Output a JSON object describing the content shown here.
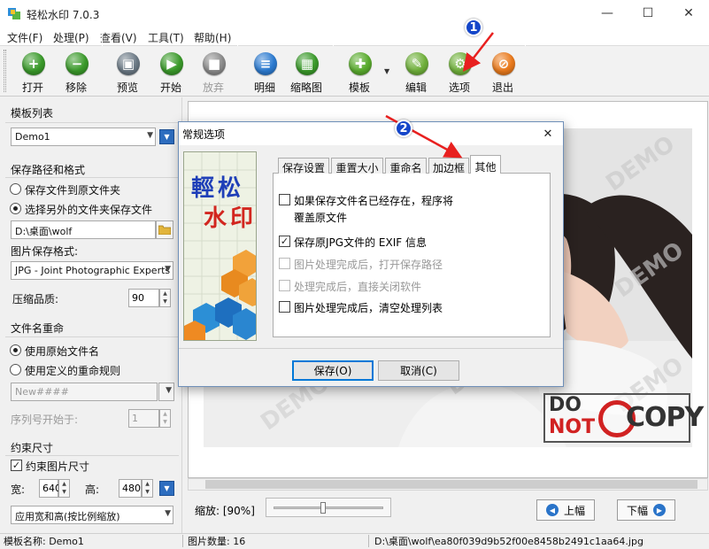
{
  "window": {
    "title": "轻松水印 7.0.3",
    "minimize_glyph": "—",
    "maximize_glyph": "☐",
    "close_glyph": "✕"
  },
  "menu": {
    "items": [
      "文件(F)",
      "处理(P)",
      "查看(V)",
      "工具(T)",
      "帮助(H)"
    ]
  },
  "toolbar": {
    "buttons": [
      {
        "label": "打开",
        "icon": "plus-icon",
        "glyph": "+",
        "color": "#3a9a2a",
        "enabled": true
      },
      {
        "label": "移除",
        "icon": "minus-icon",
        "glyph": "−",
        "color": "#3a9a2a",
        "enabled": true
      },
      {
        "label": "预览",
        "icon": "monitor-icon",
        "glyph": "▣",
        "color": "#6c7a86",
        "enabled": true
      },
      {
        "label": "开始",
        "icon": "play-icon",
        "glyph": "▶",
        "color": "#3a9a2a",
        "enabled": true
      },
      {
        "label": "放弃",
        "icon": "stop-icon",
        "glyph": "■",
        "color": "#8c8c8c",
        "enabled": false
      },
      {
        "label": "明细",
        "icon": "document-icon",
        "glyph": "≡",
        "color": "#2c7bd1",
        "enabled": true
      },
      {
        "label": "缩略图",
        "icon": "grid-icon",
        "glyph": "▦",
        "color": "#3a9a2a",
        "enabled": true
      },
      {
        "label": "模板",
        "icon": "puzzle-icon",
        "glyph": "✚",
        "color": "#5aac2e",
        "enabled": true
      },
      {
        "label": "编辑",
        "icon": "pencil-icon",
        "glyph": "✎",
        "color": "#6fb03a",
        "enabled": true
      },
      {
        "label": "选项",
        "icon": "wrench-icon",
        "glyph": "⚙",
        "color": "#6fb03a",
        "enabled": true
      },
      {
        "label": "退出",
        "icon": "power-icon",
        "glyph": "⊘",
        "color": "#ea7a1c",
        "enabled": true
      }
    ],
    "dropdown_glyph": "▼"
  },
  "left_panel": {
    "template_list_title": "模板列表",
    "template_selected": "Demo1",
    "save_section_title": "保存路径和格式",
    "save_to_original": "保存文件到原文件夹",
    "save_to_other": "选择另外的文件夹保存文件",
    "save_path": "D:\\桌面\\wolf",
    "format_label": "图片保存格式:",
    "format_value": "JPG - Joint Photographic Experts G",
    "quality_label": "压缩品质:",
    "quality_value": "90",
    "rename_section_title": "文件名重命",
    "use_original_name": "使用原始文件名",
    "use_custom_rule": "使用定义的重命规则",
    "rename_pattern": "New####",
    "seq_start_label": "序列号开始于:",
    "seq_start_value": "1",
    "constraint_section_title": "约束尺寸",
    "constrain_check_label": "约束图片尺寸",
    "width_label": "宽:",
    "width_value": "640",
    "height_label": "高:",
    "height_value": "480",
    "apply_mode": "应用宽和高(按比例缩放)"
  },
  "preview": {
    "watermark_text": "DEMO",
    "stamp_line1": "DO",
    "stamp_line2": "NOT",
    "stamp_copy": "COPY"
  },
  "bottom": {
    "zoom_label": "缩放: [90%]",
    "zoom_fraction": 0.45,
    "prev_label": "上幅",
    "next_label": "下幅"
  },
  "status": {
    "template_name": "模板名称: Demo1",
    "image_count": "图片数量:  16",
    "file_path": "D:\\桌面\\wolf\\ea80f039d9b52f00e8458b2491c1aa64.jpg"
  },
  "dialog": {
    "title": "常规选项",
    "logo_line1": "輕松",
    "logo_line2": "水印",
    "tabs": [
      "保存设置",
      "重置大小",
      "重命名",
      "加边框",
      "其他"
    ],
    "active_tab": "其他",
    "options": [
      {
        "text": "如果保存文件名已经存在，程序将",
        "text2": "覆盖原文件",
        "checked": false,
        "enabled": true
      },
      {
        "text": "保存原JPG文件的 EXIF 信息",
        "checked": true,
        "enabled": true
      },
      {
        "text": "图片处理完成后，打开保存路径",
        "checked": false,
        "enabled": false
      },
      {
        "text": "处理完成后，直接关闭软件",
        "checked": false,
        "enabled": false
      },
      {
        "text": "图片处理完成后，清空处理列表",
        "checked": false,
        "enabled": true
      }
    ],
    "save_button": "保存(O)",
    "cancel_button": "取消(C)"
  },
  "annotations": {
    "badge1": "1",
    "badge2": "2",
    "arrow_color": "#e8201f",
    "badge_color": "#1546c9"
  }
}
